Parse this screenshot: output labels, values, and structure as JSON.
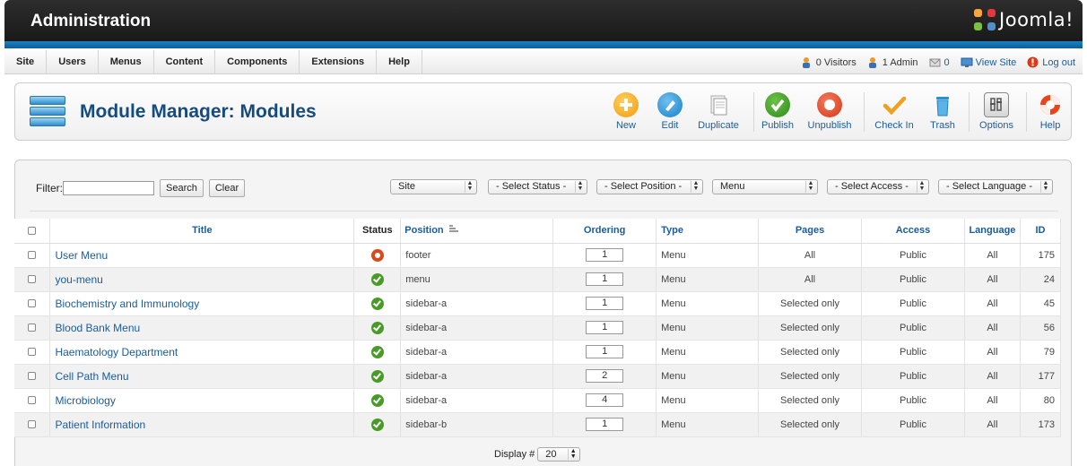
{
  "header": {
    "title": "Administration",
    "brand": "Joomla!"
  },
  "menubar": {
    "items": [
      "Site",
      "Users",
      "Menus",
      "Content",
      "Components",
      "Extensions",
      "Help"
    ],
    "status": {
      "visitors": "0 Visitors",
      "admins": "1 Admin",
      "messages": "0",
      "view_site": "View Site",
      "logout": "Log out"
    }
  },
  "toolbar": {
    "page_title": "Module Manager: Modules",
    "buttons": {
      "new": "New",
      "edit": "Edit",
      "duplicate": "Duplicate",
      "publish": "Publish",
      "unpublish": "Unpublish",
      "checkin": "Check In",
      "trash": "Trash",
      "options": "Options",
      "help": "Help"
    }
  },
  "filters": {
    "label": "Filter:",
    "search_value": "",
    "search_label": "Search",
    "clear_label": "Clear",
    "client": "Site",
    "status": "- Select Status -",
    "position": "- Select Position -",
    "type": "Menu",
    "access": "- Select Access -",
    "language": "- Select Language -"
  },
  "table": {
    "headers": {
      "title": "Title",
      "status": "Status",
      "position": "Position",
      "ordering": "Ordering",
      "type": "Type",
      "pages": "Pages",
      "access": "Access",
      "language": "Language",
      "id": "ID"
    },
    "rows": [
      {
        "title": "User Menu",
        "status": "unpublished",
        "position": "footer",
        "ordering": "1",
        "type": "Menu",
        "pages": "All",
        "access": "Public",
        "language": "All",
        "id": "175"
      },
      {
        "title": "you-menu",
        "status": "published",
        "position": "menu",
        "ordering": "1",
        "type": "Menu",
        "pages": "All",
        "access": "Public",
        "language": "All",
        "id": "24"
      },
      {
        "title": "Biochemistry and Immunology",
        "status": "published",
        "position": "sidebar-a",
        "ordering": "1",
        "type": "Menu",
        "pages": "Selected only",
        "access": "Public",
        "language": "All",
        "id": "45"
      },
      {
        "title": "Blood Bank Menu",
        "status": "published",
        "position": "sidebar-a",
        "ordering": "1",
        "type": "Menu",
        "pages": "Selected only",
        "access": "Public",
        "language": "All",
        "id": "56"
      },
      {
        "title": "Haematology Department",
        "status": "published",
        "position": "sidebar-a",
        "ordering": "1",
        "type": "Menu",
        "pages": "Selected only",
        "access": "Public",
        "language": "All",
        "id": "79"
      },
      {
        "title": "Cell Path Menu",
        "status": "published",
        "position": "sidebar-a",
        "ordering": "2",
        "type": "Menu",
        "pages": "Selected only",
        "access": "Public",
        "language": "All",
        "id": "177"
      },
      {
        "title": "Microbiology",
        "status": "published",
        "position": "sidebar-a",
        "ordering": "4",
        "type": "Menu",
        "pages": "Selected only",
        "access": "Public",
        "language": "All",
        "id": "80"
      },
      {
        "title": "Patient Information",
        "status": "published",
        "position": "sidebar-b",
        "ordering": "1",
        "type": "Menu",
        "pages": "Selected only",
        "access": "Public",
        "language": "All",
        "id": "173"
      }
    ]
  },
  "pagination": {
    "display_label": "Display #",
    "display_value": "20"
  },
  "colors": {
    "accent": "#1a5c9a",
    "header_bg": "#1e1e1e",
    "stripe": "#1a82c4",
    "published": "#4a9a2a",
    "unpublished": "#d84a1a"
  }
}
